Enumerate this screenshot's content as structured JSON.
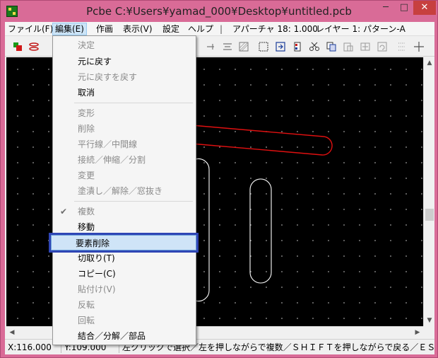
{
  "window": {
    "title": "Pcbe C:¥Users¥yamad_000¥Desktop¥untitled.pcb",
    "minimize_glyph": "─",
    "maximize_glyph": "□",
    "close_glyph": "✕"
  },
  "menubar": {
    "items": [
      "ファイル(F)",
      "編集(E)",
      "作画",
      "表示(V)",
      "設定",
      "ヘルプ"
    ],
    "separator": "|",
    "aperture": "アパーチャ 18: 1.000",
    "layer": "レイヤー 1: パターン-A"
  },
  "edit_menu": {
    "items": [
      {
        "label": "決定",
        "enabled": false
      },
      {
        "label": "元に戻す",
        "enabled": true
      },
      {
        "label": "元に戻すを戻す",
        "enabled": false
      },
      {
        "label": "取消",
        "enabled": true
      },
      {
        "label": "変形",
        "enabled": false
      },
      {
        "label": "削除",
        "enabled": false
      },
      {
        "label": "平行線／中間線",
        "enabled": false
      },
      {
        "label": "接続／伸縮／分割",
        "enabled": false
      },
      {
        "label": "変更",
        "enabled": false
      },
      {
        "label": "塗潰し／解除／窓抜き",
        "enabled": false
      },
      {
        "label": "複数",
        "enabled": false,
        "checked": true
      },
      {
        "label": "移動",
        "enabled": true
      },
      {
        "label": "要素削除",
        "enabled": true,
        "highlighted": true
      },
      {
        "label": "切取り(T)",
        "enabled": true
      },
      {
        "label": "コピー(C)",
        "enabled": true
      },
      {
        "label": "貼付け(V)",
        "enabled": false
      },
      {
        "label": "反転",
        "enabled": false
      },
      {
        "label": "回転",
        "enabled": false
      },
      {
        "label": "結合／分解／部品",
        "enabled": true
      }
    ],
    "check_glyph": "✔"
  },
  "status": {
    "x": "X:116.000",
    "y": "Y:109.000",
    "message": "左クリックで選択／左を押しながらで複数／ＳＨＩＦＴを押しながらで戻る／ＥＳＣで取消"
  },
  "colors": {
    "title_bar": "#d96b97",
    "canvas_bg": "#000000",
    "trace_red": "#e01010",
    "trace_white": "#ffffff",
    "highlight_border": "#2f46b5"
  }
}
